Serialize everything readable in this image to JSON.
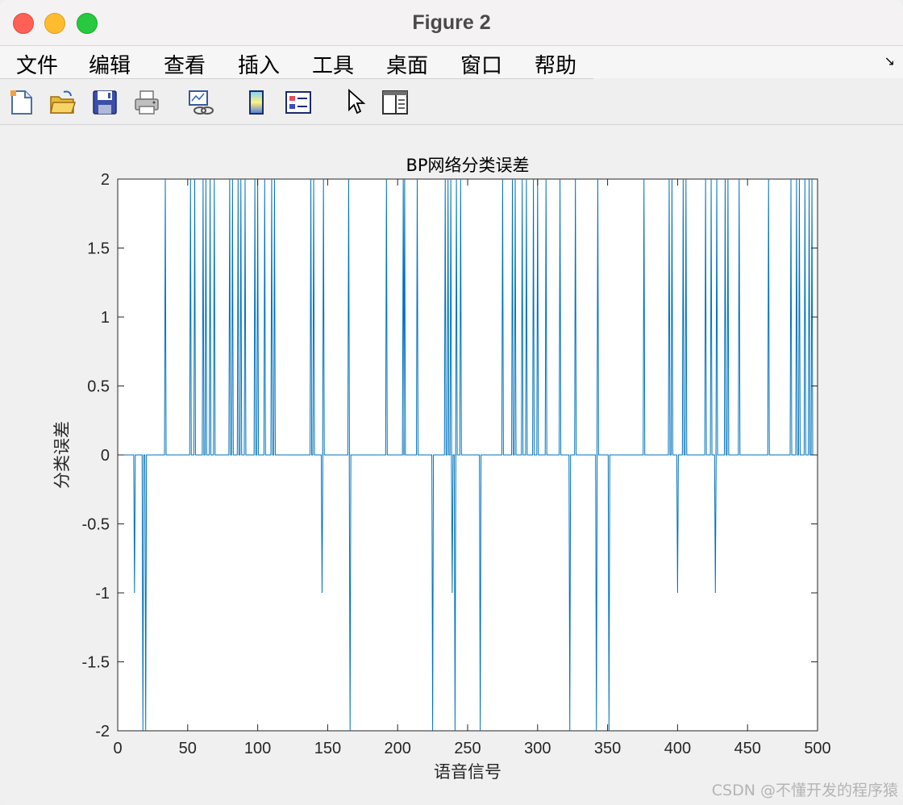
{
  "window": {
    "title": "Figure 2"
  },
  "menu": [
    "文件",
    "编辑",
    "查看",
    "插入",
    "工具",
    "桌面",
    "窗口",
    "帮助"
  ],
  "expand_glyph": "↘",
  "toolbar_icons": [
    "new-figure-icon",
    "open-file-icon",
    "save-icon",
    "print-icon",
    "link-plot-icon",
    "colorbar-icon",
    "legend-icon",
    "pointer-icon",
    "property-editor-icon"
  ],
  "chart_data": {
    "type": "line",
    "title": "BP网络分类误差",
    "xlabel": "语音信号",
    "ylabel": "分类误差",
    "xlim": [
      0,
      500
    ],
    "ylim": [
      -2,
      2
    ],
    "xticks": [
      0,
      50,
      100,
      150,
      200,
      250,
      300,
      350,
      400,
      450,
      500
    ],
    "yticks": [
      2,
      1.5,
      1,
      0.5,
      0,
      -0.5,
      -1,
      -1.5,
      -2
    ],
    "grid": false,
    "series_color": "#0072bd",
    "impulses": [
      [
        12,
        -1
      ],
      [
        18,
        -2
      ],
      [
        20,
        -2
      ],
      [
        34,
        2
      ],
      [
        52,
        2
      ],
      [
        55,
        2
      ],
      [
        61,
        2
      ],
      [
        63,
        2
      ],
      [
        66,
        2
      ],
      [
        69,
        2
      ],
      [
        80,
        2
      ],
      [
        82,
        2
      ],
      [
        86,
        2
      ],
      [
        88,
        2
      ],
      [
        91,
        2
      ],
      [
        98,
        2
      ],
      [
        100,
        2
      ],
      [
        105,
        2
      ],
      [
        110,
        2
      ],
      [
        112,
        2
      ],
      [
        138,
        2
      ],
      [
        140,
        2
      ],
      [
        146,
        -1
      ],
      [
        147,
        2
      ],
      [
        165,
        2
      ],
      [
        166,
        -2
      ],
      [
        192,
        2
      ],
      [
        204,
        2
      ],
      [
        205,
        2
      ],
      [
        214,
        2
      ],
      [
        225,
        -2
      ],
      [
        234,
        2
      ],
      [
        236,
        2
      ],
      [
        238,
        2
      ],
      [
        239,
        -1
      ],
      [
        241,
        -2
      ],
      [
        242,
        2
      ],
      [
        245,
        2
      ],
      [
        259,
        -2
      ],
      [
        275,
        2
      ],
      [
        282,
        2
      ],
      [
        284,
        2
      ],
      [
        289,
        2
      ],
      [
        292,
        2
      ],
      [
        297,
        2
      ],
      [
        300,
        2
      ],
      [
        306,
        2
      ],
      [
        316,
        2
      ],
      [
        323,
        -2
      ],
      [
        327,
        2
      ],
      [
        342,
        -2
      ],
      [
        343,
        2
      ],
      [
        351,
        -2
      ],
      [
        376,
        2
      ],
      [
        394,
        2
      ],
      [
        396,
        2
      ],
      [
        400,
        -1
      ],
      [
        404,
        2
      ],
      [
        406,
        2
      ],
      [
        420,
        2
      ],
      [
        424,
        2
      ],
      [
        427,
        -1
      ],
      [
        428,
        2
      ],
      [
        434,
        2
      ],
      [
        436,
        2
      ],
      [
        444,
        2
      ],
      [
        465,
        2
      ],
      [
        481,
        2
      ],
      [
        485,
        2
      ],
      [
        487,
        2
      ],
      [
        491,
        2
      ],
      [
        494,
        2
      ],
      [
        496,
        2
      ]
    ]
  },
  "watermark": "CSDN @不懂开发的程序猿"
}
